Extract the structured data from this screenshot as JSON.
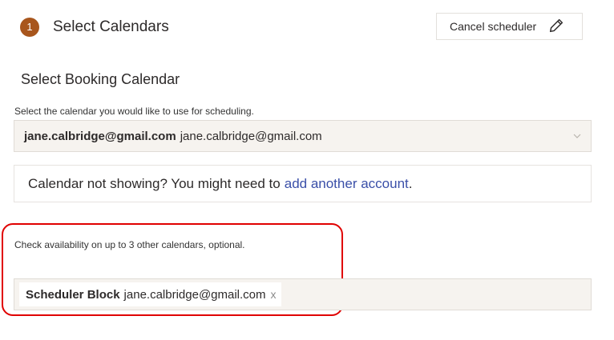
{
  "step": {
    "number": "1",
    "title": "Select Calendars"
  },
  "cancel": {
    "label": "Cancel scheduler",
    "icon": "pencil-icon"
  },
  "booking": {
    "title": "Select Booking Calendar",
    "hint": "Select the calendar you would like to use for scheduling.",
    "selected_name": "jane.calbridge@gmail.com",
    "selected_email": "jane.calbridge@gmail.com"
  },
  "notice": {
    "prefix": "Calendar not showing? You might need to",
    "link": "add another account",
    "suffix": "."
  },
  "availability": {
    "hint": "Check availability on up to 3 other calendars, optional.",
    "chips": [
      {
        "name": "Scheduler Block",
        "email": "jane.calbridge@gmail.com",
        "remove": "x"
      }
    ]
  },
  "colors": {
    "accent": "#a8561d",
    "link": "#3a4fa8",
    "highlight": "#e00000"
  }
}
